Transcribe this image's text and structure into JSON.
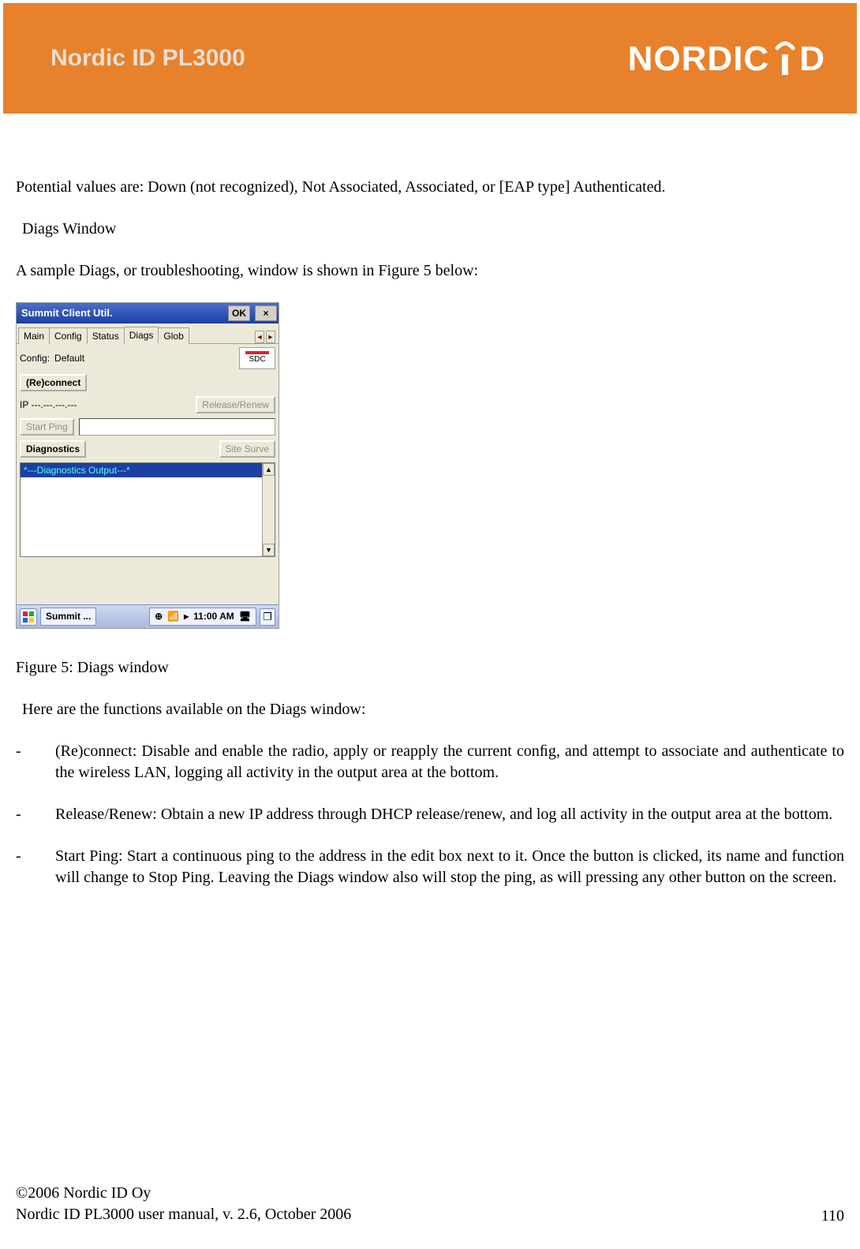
{
  "header": {
    "title": "Nordic ID PL3000",
    "brand": "NORDIC",
    "brand_suffix": "D"
  },
  "body": {
    "p1": "Potential values are: Down (not recognized), Not Associated, Associated, or [EAP type] Authenticated.",
    "p2": "Diags Window",
    "p3": "A sample Diags, or troubleshooting, window is shown in Figure 5 below:",
    "fig_caption": "Figure 5: Diags window",
    "p4": "Here are the functions available on the Diags window:",
    "bullets": [
      "(Re)connect: Disable and enable the radio, apply or reapply the current conﬁg, and attempt to associate and authenticate to the wireless LAN, logging all activity in the output area at the bottom.",
      "Release/Renew: Obtain a new IP address through DHCP release/renew, and log all activity in the output area at the bottom.",
      "Start Ping: Start a continuous ping to the address in the edit box next to it.  Once the button is clicked, its name and function will change to Stop Ping.  Leaving the Diags window also will stop the ping, as will pressing any other button on the screen."
    ]
  },
  "footer": {
    "line1": "©2006 Nordic ID Oy",
    "line2": "Nordic ID PL3000 user manual, v. 2.6, October 2006",
    "page": "110"
  },
  "scu": {
    "title": "Summit Client Util.",
    "ok": "OK",
    "close": "×",
    "tabs": [
      "Main",
      "Config",
      "Status",
      "Diags",
      "Glob"
    ],
    "active_tab": 3,
    "config_label": "Config:",
    "config_value": "Default",
    "sdc": "SDC",
    "reconnect": "(Re)connect",
    "release": "Release/Renew",
    "ip": "IP ---.---.---.---",
    "start_ping": "Start Ping",
    "diagnostics": "Diagnostics",
    "site_survey": "Site Surve",
    "output_header": "*---Diagnostics Output---*",
    "task_btn": "Summit ...",
    "clock": "11:00 AM"
  }
}
